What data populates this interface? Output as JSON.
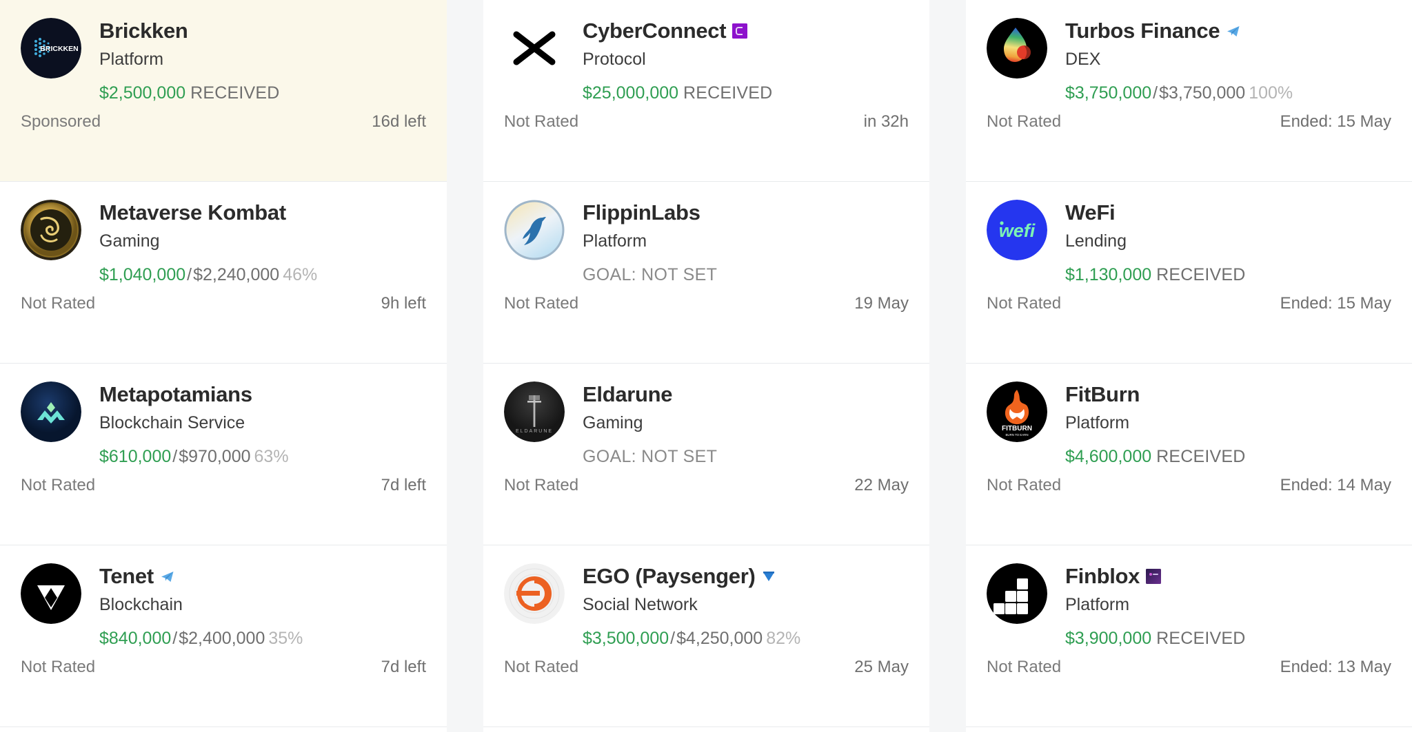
{
  "columns": [
    {
      "id": "column-1",
      "cards": [
        {
          "name": "Brickken",
          "category": "Platform",
          "raised": "$2,500,000",
          "goal": "",
          "percent": "",
          "received_label": "RECEIVED",
          "goal_not_set": "",
          "rating": "Sponsored",
          "date": "16d left",
          "sponsored": true,
          "badge": "none",
          "logo": "brickken-logo"
        },
        {
          "name": "Metaverse Kombat",
          "category": "Gaming",
          "raised": "$1,040,000",
          "goal": "$2,240,000",
          "percent": "46%",
          "received_label": "",
          "goal_not_set": "",
          "rating": "Not Rated",
          "date": "9h left",
          "sponsored": false,
          "badge": "none",
          "logo": "metaverse-kombat-logo"
        },
        {
          "name": "Metapotamians",
          "category": "Blockchain Service",
          "raised": "$610,000",
          "goal": "$970,000",
          "percent": "63%",
          "received_label": "",
          "goal_not_set": "",
          "rating": "Not Rated",
          "date": "7d left",
          "sponsored": false,
          "badge": "none",
          "logo": "metapotamians-logo"
        },
        {
          "name": "Tenet",
          "category": "Blockchain",
          "raised": "$840,000",
          "goal": "$2,400,000",
          "percent": "35%",
          "received_label": "",
          "goal_not_set": "",
          "rating": "Not Rated",
          "date": "7d left",
          "sponsored": false,
          "badge": "telegram-blue",
          "logo": "tenet-logo"
        }
      ]
    },
    {
      "id": "column-2",
      "cards": [
        {
          "name": "CyberConnect",
          "category": "Protocol",
          "raised": "$25,000,000",
          "goal": "",
          "percent": "",
          "received_label": "RECEIVED",
          "goal_not_set": "",
          "rating": "Not Rated",
          "date": "in 32h",
          "sponsored": false,
          "badge": "purple-square",
          "logo": "cyberconnect-logo"
        },
        {
          "name": "FlippinLabs",
          "category": "Platform",
          "raised": "",
          "goal": "",
          "percent": "",
          "received_label": "",
          "goal_not_set": "GOAL: NOT SET",
          "rating": "Not Rated",
          "date": "19 May",
          "sponsored": false,
          "badge": "none",
          "logo": "flippinlabs-logo"
        },
        {
          "name": "Eldarune",
          "category": "Gaming",
          "raised": "",
          "goal": "",
          "percent": "",
          "received_label": "",
          "goal_not_set": "GOAL: NOT SET",
          "rating": "Not Rated",
          "date": "22 May",
          "sponsored": false,
          "badge": "none",
          "logo": "eldarune-logo"
        },
        {
          "name": "EGO (Paysenger)",
          "category": "Social Network",
          "raised": "$3,500,000",
          "goal": "$4,250,000",
          "percent": "82%",
          "received_label": "",
          "goal_not_set": "",
          "rating": "Not Rated",
          "date": "25 May",
          "sponsored": false,
          "badge": "ton-blue",
          "logo": "ego-paysenger-logo"
        }
      ]
    },
    {
      "id": "column-3",
      "cards": [
        {
          "name": "Turbos Finance",
          "category": "DEX",
          "raised": "$3,750,000",
          "goal": "$3,750,000",
          "percent": "100%",
          "received_label": "",
          "goal_not_set": "",
          "rating": "Not Rated",
          "date": "Ended: 15 May",
          "sponsored": false,
          "badge": "telegram-blue",
          "logo": "turbos-finance-logo"
        },
        {
          "name": "WeFi",
          "category": "Lending",
          "raised": "$1,130,000",
          "goal": "",
          "percent": "",
          "received_label": "RECEIVED",
          "goal_not_set": "",
          "rating": "Not Rated",
          "date": "Ended: 15 May",
          "sponsored": false,
          "badge": "none",
          "logo": "wefi-logo"
        },
        {
          "name": "FitBurn",
          "category": "Platform",
          "raised": "$4,600,000",
          "goal": "",
          "percent": "",
          "received_label": "RECEIVED",
          "goal_not_set": "",
          "rating": "Not Rated",
          "date": "Ended: 14 May",
          "sponsored": false,
          "badge": "none",
          "logo": "fitburn-logo"
        },
        {
          "name": "Finblox",
          "category": "Platform",
          "raised": "$3,900,000",
          "goal": "",
          "percent": "",
          "received_label": "RECEIVED",
          "goal_not_set": "",
          "rating": "Not Rated",
          "date": "Ended: 13 May",
          "sponsored": false,
          "badge": "dark-purple-square",
          "logo": "finblox-logo"
        }
      ]
    }
  ],
  "colors": {
    "raised_green": "#2f9e52",
    "sponsored_bg": "#fbf8ea",
    "muted": "#6f6f6f",
    "percent_grey": "#b4b4b4"
  },
  "separators": {
    "slash": "/"
  }
}
